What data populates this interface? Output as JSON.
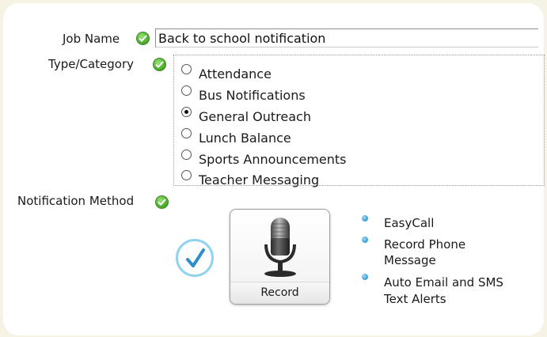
{
  "form": {
    "job_name_label": "Job Name",
    "job_name_value": "Back to school notification",
    "type_category_label": "Type/Category",
    "categories": [
      {
        "label": "Attendance",
        "selected": false
      },
      {
        "label": "Bus Notifications",
        "selected": false
      },
      {
        "label": "General Outreach",
        "selected": true
      },
      {
        "label": "Lunch Balance",
        "selected": false
      },
      {
        "label": "Sports Announcements",
        "selected": false
      },
      {
        "label": "Teacher Messaging",
        "selected": false
      }
    ],
    "notification_method_label": "Notification Method"
  },
  "record_button": {
    "label": "Record",
    "icon": "microphone-icon"
  },
  "method_options": [
    {
      "line1": "EasyCall",
      "line2": ""
    },
    {
      "line1": "Record Phone",
      "line2": "Message"
    },
    {
      "line1": "Auto Email and SMS",
      "line2": "Text Alerts"
    }
  ],
  "colors": {
    "valid_check": "#4fae2f",
    "selected_check": "#3a9bd5",
    "bullet": "#3a9bd5",
    "background": "#f6f2e4"
  }
}
